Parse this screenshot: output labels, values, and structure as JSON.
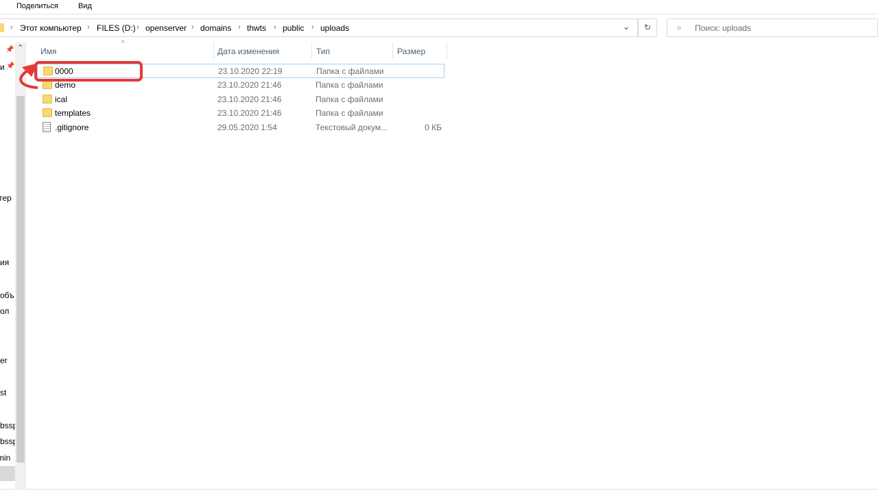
{
  "ribbon": {
    "tabs": [
      "Поделиться",
      "Вид"
    ]
  },
  "address": {
    "crumbs": [
      "Этот компьютер",
      "FILES (D:)",
      "openserver",
      "domains",
      "thwts",
      "public",
      "uploads"
    ],
    "separator": "›",
    "dropdown_icon": "chevron-down",
    "refresh_icon": "refresh"
  },
  "search": {
    "placeholder": "Поиск: uploads"
  },
  "nav": {
    "items": [
      "и",
      "тер",
      "ия",
      "объ",
      "ол",
      "er",
      "st",
      "rbssp",
      "rbssp",
      "min"
    ]
  },
  "columns": {
    "name": "Имя",
    "date": "Дата изменения",
    "type": "Тип",
    "size": "Размер"
  },
  "files": [
    {
      "name": "0000",
      "date": "23.10.2020 22:19",
      "type": "Папка с файлами",
      "size": "",
      "kind": "folder"
    },
    {
      "name": "demo",
      "date": "23.10.2020 21:46",
      "type": "Папка с файлами",
      "size": "",
      "kind": "folder"
    },
    {
      "name": "ical",
      "date": "23.10.2020 21:46",
      "type": "Папка с файлами",
      "size": "",
      "kind": "folder"
    },
    {
      "name": "templates",
      "date": "23.10.2020 21:46",
      "type": "Папка с файлами",
      "size": "",
      "kind": "folder"
    },
    {
      "name": ".gitignore",
      "date": "29.05.2020 1:54",
      "type": "Текстовый докум...",
      "size": "0 КБ",
      "kind": "file"
    }
  ],
  "annotation_color": "#e53935"
}
